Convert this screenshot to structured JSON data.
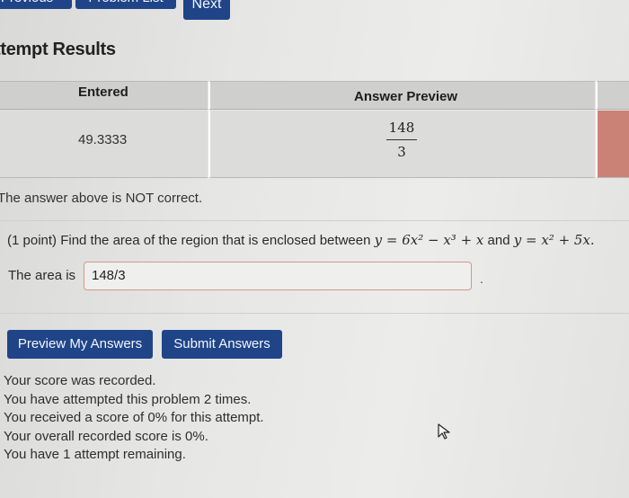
{
  "nav": {
    "previous": "Previous",
    "problem_list": "Problem List",
    "next": "Next"
  },
  "results": {
    "heading": "ttempt Results",
    "columns": [
      "Entered",
      "Answer Preview"
    ],
    "rows": [
      {
        "entered": "49.3333",
        "preview_numerator": "148",
        "preview_denominator": "3",
        "status_color": "#c98275"
      }
    ]
  },
  "feedback": "The answer above is NOT correct.",
  "problem": {
    "points": "(1 point)",
    "text_before": "Find the area of the region that is enclosed between",
    "curve1_lhs": "y",
    "curve1_rhs": "6x² − x³ + x",
    "conjunction": "and",
    "curve2_lhs": "y",
    "curve2_rhs": "x² + 5x.",
    "answer_label": "The area is",
    "answer_value": "148/3"
  },
  "actions": {
    "preview_label": "Preview My Answers",
    "submit_label": "Submit Answers"
  },
  "score_messages": [
    "Your score was recorded.",
    "You have attempted this problem 2 times.",
    "You received a score of 0% for this attempt.",
    "Your overall recorded score is 0%.",
    "You have 1 attempt remaining."
  ],
  "colors": {
    "button": "#1f4488",
    "incorrect": "#c98275"
  }
}
